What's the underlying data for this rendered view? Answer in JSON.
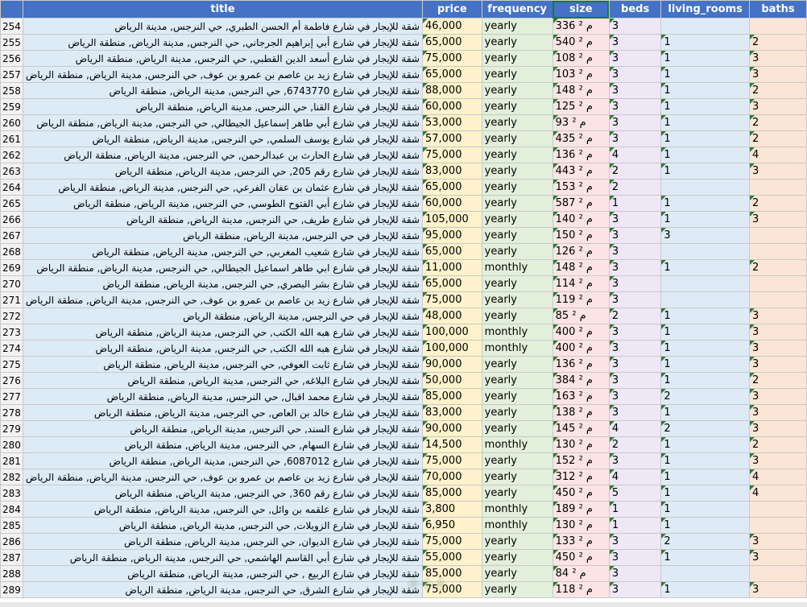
{
  "headers": {
    "title": "title",
    "price": "price",
    "frequency": "frequency",
    "size": "size",
    "beds": "beds",
    "living_rooms": "living_rooms",
    "baths": "baths"
  },
  "rows": [
    {
      "n": "254",
      "title": "شقة للإيجار في شارع فاطمة أم الحسن الطبري, حي النرجس, مدينة الرياض",
      "price": "46,000",
      "frequency": "yearly",
      "size": "336 م ²",
      "beds": "3",
      "living": "",
      "baths": ""
    },
    {
      "n": "255",
      "title": "شقة للإيجار في شارع أبي إبراهيم الجرجاني, حي النرجس, مدينة الرياض, منطقة الرياض",
      "price": "65,000",
      "frequency": "yearly",
      "size": "540 م ²",
      "beds": "3",
      "living": "1",
      "baths": "2"
    },
    {
      "n": "256",
      "title": "شقة للإيجار في شارع أسعد الدين القطبي, حي النرجس, مدينة الرياض, منطقة الرياض",
      "price": "75,000",
      "frequency": "yearly",
      "size": "108 م ²",
      "beds": "3",
      "living": "1",
      "baths": "3"
    },
    {
      "n": "257",
      "title": "شقة للإيجار في شارع زيد بن عاصم بن عمرو بن عوف, حي النرجس, مدينة الرياض, منطقة الرياض",
      "price": "65,000",
      "frequency": "yearly",
      "size": "103 م ²",
      "beds": "3",
      "living": "1",
      "baths": "3"
    },
    {
      "n": "258",
      "title": "شقة للإيجار في شارع 6743770, حي النرجس, مدينة الرياض, منطقة الرياض",
      "price": "88,000",
      "frequency": "yearly",
      "size": "148 م ²",
      "beds": "3",
      "living": "1",
      "baths": "2"
    },
    {
      "n": "259",
      "title": "شقة للإيجار في شارع القنا, حي النرجس, مدينة الرياض, منطقة الرياض",
      "price": "60,000",
      "frequency": "yearly",
      "size": "125 م ²",
      "beds": "3",
      "living": "1",
      "baths": "3"
    },
    {
      "n": "260",
      "title": "شقة للإيجار في شارع أبي طاهر إسماعيل الجيطالي, حي النرجس, مدينة الرياض, منطقة الرياض",
      "price": "53,000",
      "frequency": "yearly",
      "size": "93 م ²",
      "beds": "3",
      "living": "1",
      "baths": "2"
    },
    {
      "n": "261",
      "title": "شقة للإيجار في شارع يوسف السلمي, حي النرجس, مدينة الرياض, منطقة الرياض",
      "price": "57,000",
      "frequency": "yearly",
      "size": "435 م ²",
      "beds": "3",
      "living": "1",
      "baths": "2"
    },
    {
      "n": "262",
      "title": "شقة للإيجار في شارع الحارث بن عبدالرحمن, حي النرجس, مدينة الرياض, منطقة الرياض",
      "price": "75,000",
      "frequency": "yearly",
      "size": "136 م ²",
      "beds": "4",
      "living": "1",
      "baths": "4"
    },
    {
      "n": "263",
      "title": "شقة للإيجار في شارع رقم 205, حي النرجس, مدينة الرياض, منطقة الرياض",
      "price": "83,000",
      "frequency": "yearly",
      "size": "443 م ²",
      "beds": "2",
      "living": "1",
      "baths": "3"
    },
    {
      "n": "264",
      "title": "شقة للإيجار في شارع عثمان بن عفان الفرعي, حي النرجس, مدينة الرياض, منطقة الرياض",
      "price": "65,000",
      "frequency": "yearly",
      "size": "153 م ²",
      "beds": "2",
      "living": "",
      "baths": ""
    },
    {
      "n": "265",
      "title": "شقة للإيجار في شارع أبي الفتوح الطوسي, حي النرجس, مدينة الرياض, منطقة الرياض",
      "price": "60,000",
      "frequency": "yearly",
      "size": "587 م ²",
      "beds": "1",
      "living": "1",
      "baths": "2"
    },
    {
      "n": "266",
      "title": "شقة للإيجار في شارع طريف, حي النرجس, مدينة الرياض, منطقة الرياض",
      "price": "105,000",
      "frequency": "yearly",
      "size": "140 م ²",
      "beds": "3",
      "living": "1",
      "baths": "3"
    },
    {
      "n": "267",
      "title": "شقة للإيجار في حي النرجس, مدينة الرياض, منطقة الرياض",
      "price": "95,000",
      "frequency": "yearly",
      "size": "150 م ²",
      "beds": "3",
      "living": "3",
      "baths": ""
    },
    {
      "n": "268",
      "title": "شقة للإيجار في شارع شعيب المغربي, حي النرجس, مدينة الرياض, منطقة الرياض",
      "price": "65,000",
      "frequency": "yearly",
      "size": "126 م ²",
      "beds": "3",
      "living": "",
      "baths": ""
    },
    {
      "n": "269",
      "title": "شقة للإيجار في شارع ابي طاهر اسماعيل الجيطالي, حي النرجس, مدينة الرياض, منطقة الرياض",
      "price": "11,000",
      "frequency": "monthly",
      "size": "148 م ²",
      "beds": "3",
      "living": "1",
      "baths": "2"
    },
    {
      "n": "270",
      "title": "شقة للإيجار في شارع بشر البصري, حي النرجس, مدينة الرياض, منطقة الرياض",
      "price": "65,000",
      "frequency": "yearly",
      "size": "114 م ²",
      "beds": "3",
      "living": "",
      "baths": ""
    },
    {
      "n": "271",
      "title": "شقة للإيجار في شارع زيد بن عاصم بن عمرو بن عوف, حي النرجس, مدينة الرياض, منطقة الرياض",
      "price": "75,000",
      "frequency": "yearly",
      "size": "119 م ²",
      "beds": "3",
      "living": "",
      "baths": ""
    },
    {
      "n": "272",
      "title": "شقة للإيجار في حي النرجس, مدينة الرياض, منطقة الرياض",
      "price": "48,000",
      "frequency": "yearly",
      "size": "85 م ²",
      "beds": "2",
      "living": "1",
      "baths": "3"
    },
    {
      "n": "273",
      "title": "شقة للإيجار في شارع هبه الله الكتب, حي النرجس, مدينة الرياض, منطقة الرياض",
      "price": "100,000",
      "frequency": "monthly",
      "size": "400 م ²",
      "beds": "3",
      "living": "1",
      "baths": "3"
    },
    {
      "n": "274",
      "title": "شقة للإيجار في شارع هبه الله الكتب, حي النرجس, مدينة الرياض, منطقة الرياض",
      "price": "100,000",
      "frequency": "monthly",
      "size": "400 م ²",
      "beds": "3",
      "living": "1",
      "baths": "3"
    },
    {
      "n": "275",
      "title": "شقة للإيجار في شارع ثابت العوفي, حي النرجس, مدينة الرياض, منطقة الرياض",
      "price": "90,000",
      "frequency": "yearly",
      "size": "136 م ²",
      "beds": "3",
      "living": "1",
      "baths": "3"
    },
    {
      "n": "276",
      "title": "شقة للإيجار في شارع البلاغه, حي النرجس, مدينة الرياض, منطقة الرياض",
      "price": "50,000",
      "frequency": "yearly",
      "size": "384 م ²",
      "beds": "3",
      "living": "1",
      "baths": "2"
    },
    {
      "n": "277",
      "title": "شقة للإيجار في شارع محمد اقبال, حي النرجس, مدينة الرياض, منطقة الرياض",
      "price": "85,000",
      "frequency": "yearly",
      "size": "163 م ²",
      "beds": "3",
      "living": "2",
      "baths": "3"
    },
    {
      "n": "278",
      "title": "شقة للإيجار في شارع خالد بن العاص, حي النرجس, مدينة الرياض, منطقة الرياض",
      "price": "83,000",
      "frequency": "yearly",
      "size": "138 م ²",
      "beds": "3",
      "living": "1",
      "baths": "3"
    },
    {
      "n": "279",
      "title": "شقة للإيجار في شارع السند, حي النرجس, مدينة الرياض, منطقة الرياض",
      "price": "90,000",
      "frequency": "yearly",
      "size": "145 م ²",
      "beds": "4",
      "living": "2",
      "baths": "3"
    },
    {
      "n": "280",
      "title": "شقة للإيجار في شارع السهام, حي النرجس, مدينة الرياض, منطقة الرياض",
      "price": "14,500",
      "frequency": "monthly",
      "size": "130 م ²",
      "beds": "2",
      "living": "1",
      "baths": "2"
    },
    {
      "n": "281",
      "title": "شقة للإيجار في شارع 6087012, حي النرجس, مدينة الرياض, منطقة الرياض",
      "price": "75,000",
      "frequency": "yearly",
      "size": "152 م ²",
      "beds": "3",
      "living": "1",
      "baths": "3"
    },
    {
      "n": "282",
      "title": "شقة للإيجار في شارع زيد بن عاصم بن عمرو بن عوف, حي النرجس, مدينة الرياض, منطقة الرياض",
      "price": "70,000",
      "frequency": "yearly",
      "size": "312 م ²",
      "beds": "4",
      "living": "1",
      "baths": "4"
    },
    {
      "n": "283",
      "title": "شقة للإيجار في شارع رقم 360, حي النرجس, مدينة الرياض, منطقة الرياض",
      "price": "85,000",
      "frequency": "yearly",
      "size": "450 م ²",
      "beds": "5",
      "living": "1",
      "baths": "4"
    },
    {
      "n": "284",
      "title": "شقة للإيجار في شارع علقمه بن وائل, حي النرجس, مدينة الرياض, منطقة الرياض",
      "price": "3,800",
      "frequency": "monthly",
      "size": "189 م ²",
      "beds": "1",
      "living": "1",
      "baths": ""
    },
    {
      "n": "285",
      "title": "شقة للإيجار في شارع الزويلات, حي النرجس, مدينة الرياض, منطقة الرياض",
      "price": "6,950",
      "frequency": "monthly",
      "size": "130 م ²",
      "beds": "1",
      "living": "1",
      "baths": ""
    },
    {
      "n": "286",
      "title": "شقة للإيجار في شارع الديوان, حي النرجس, مدينة الرياض, منطقة الرياض",
      "price": "75,000",
      "frequency": "yearly",
      "size": "133 م ²",
      "beds": "3",
      "living": "2",
      "baths": "3"
    },
    {
      "n": "287",
      "title": "شقة للإيجار في شارع أبي القاسم الهاشمي, حي النرجس, مدينة الرياض, منطقة الرياض",
      "price": "55,000",
      "frequency": "yearly",
      "size": "450 م ²",
      "beds": "3",
      "living": "1",
      "baths": "3"
    },
    {
      "n": "288",
      "title": "شقة للإيجار في شارع الربيع , حي النرجس, مدينة الرياض, منطقة الرياض",
      "price": "85,000",
      "frequency": "yearly",
      "size": "84 م ²",
      "beds": "3",
      "living": "",
      "baths": ""
    },
    {
      "n": "289",
      "title": "شقة للإيجار في شارع الشرق, حي النرجس, مدينة الرياض, منطقة الرياض",
      "price": "75,000",
      "frequency": "yearly",
      "size": "118 م ²",
      "beds": "3",
      "living": "1",
      "baths": "3"
    }
  ]
}
